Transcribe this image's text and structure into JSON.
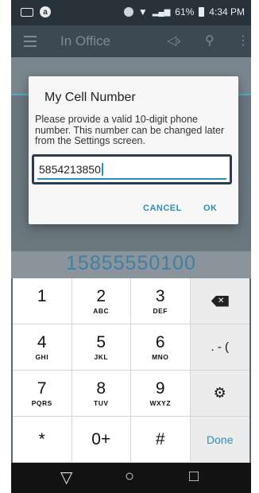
{
  "status_bar": {
    "a_icon": "a",
    "battery": "61%",
    "time": "4:34 PM",
    "icons": [
      "keyboard-icon",
      "bluetooth-icon",
      "wifi-icon",
      "signal-icon",
      "battery-icon"
    ]
  },
  "app_bar": {
    "title": "In Office",
    "speaker_glyph": "◁›",
    "pin_glyph": "⚲",
    "more_glyph": "⋮"
  },
  "dialog": {
    "title": "My Cell Number",
    "message": "Please provide a valid 10-digit phone number. This number can be changed later from the Settings screen.",
    "input_value": "5854213850",
    "cancel": "CANCEL",
    "ok": "OK"
  },
  "background_number": "15855550100",
  "keypad": {
    "keys": [
      {
        "digit": "1",
        "sub": ""
      },
      {
        "digit": "2",
        "sub": "ABC"
      },
      {
        "digit": "3",
        "sub": "DEF"
      },
      {
        "digit": "",
        "sub": ""
      },
      {
        "digit": "4",
        "sub": "GHI"
      },
      {
        "digit": "5",
        "sub": "JKL"
      },
      {
        "digit": "6",
        "sub": "MNO"
      },
      {
        "digit": ". - (",
        "sub": ""
      },
      {
        "digit": "7",
        "sub": "PQRS"
      },
      {
        "digit": "8",
        "sub": "TUV"
      },
      {
        "digit": "9",
        "sub": "WXYZ"
      },
      {
        "digit": "",
        "sub": ""
      },
      {
        "digit": "*",
        "sub": ""
      },
      {
        "digit": "0+",
        "sub": ""
      },
      {
        "digit": "#",
        "sub": ""
      },
      {
        "digit": "Done",
        "sub": ""
      }
    ]
  },
  "nav_bar": {
    "back": "▽",
    "home": "○",
    "recents": "□"
  },
  "colors": {
    "accent": "#2b8fb6",
    "status_bar": "#27323a",
    "app_bar": "#3c4952"
  }
}
